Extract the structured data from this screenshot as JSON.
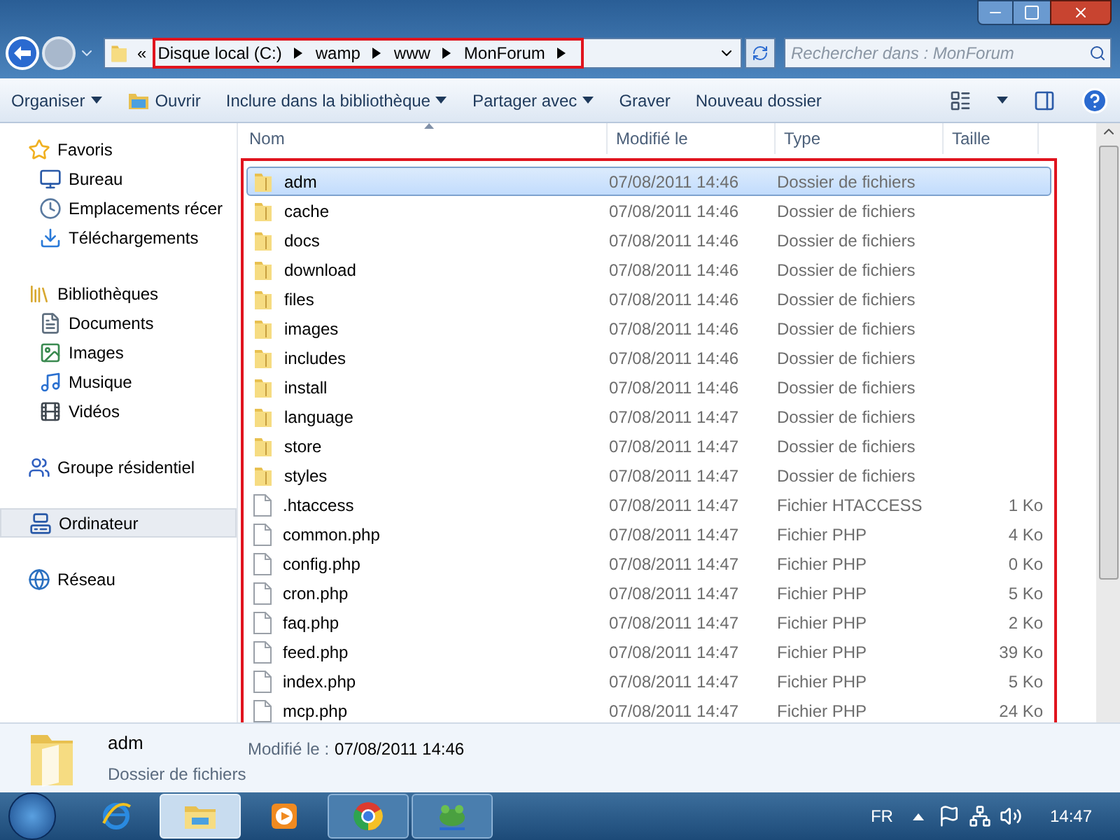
{
  "address": {
    "overflow": "«",
    "crumbs": [
      "Disque local (C:)",
      "wamp",
      "www",
      "MonForum"
    ]
  },
  "search": {
    "placeholder": "Rechercher dans : MonForum"
  },
  "toolbar": [
    {
      "label": "Organiser",
      "dropdown": true,
      "icon": false
    },
    {
      "label": "Ouvrir",
      "dropdown": false,
      "icon": true
    },
    {
      "label": "Inclure dans la bibliothèque",
      "dropdown": true,
      "icon": false
    },
    {
      "label": "Partager avec",
      "dropdown": true,
      "icon": false
    },
    {
      "label": "Graver",
      "dropdown": false,
      "icon": false
    },
    {
      "label": "Nouveau dossier",
      "dropdown": false,
      "icon": false
    }
  ],
  "sidebar": [
    {
      "label": "Favoris",
      "kind": "star",
      "selected": false,
      "children": [
        {
          "label": "Bureau",
          "kind": "desktop",
          "selected": false
        },
        {
          "label": "Emplacements récer",
          "kind": "recent",
          "selected": false
        },
        {
          "label": "Téléchargements",
          "kind": "download",
          "selected": false
        }
      ]
    },
    {
      "label": "Bibliothèques",
      "kind": "library",
      "selected": false,
      "children": [
        {
          "label": "Documents",
          "kind": "document",
          "selected": false
        },
        {
          "label": "Images",
          "kind": "image",
          "selected": false
        },
        {
          "label": "Musique",
          "kind": "music",
          "selected": false
        },
        {
          "label": "Vidéos",
          "kind": "video",
          "selected": false
        }
      ]
    },
    {
      "label": "Groupe résidentiel",
      "kind": "homegroup",
      "selected": false
    },
    {
      "label": "Ordinateur",
      "kind": "computer",
      "selected": true
    },
    {
      "label": "Réseau",
      "kind": "network",
      "selected": false
    }
  ],
  "table": {
    "columns": [
      {
        "label": "Nom",
        "sorted": true
      },
      {
        "label": "Modifié le",
        "sorted": false
      },
      {
        "label": "Type",
        "sorted": false
      },
      {
        "label": "Taille",
        "sorted": false
      }
    ],
    "rows": [
      {
        "name": "adm",
        "date": "07/08/2011 14:46",
        "type": "Dossier de fichiers",
        "kind": "folder",
        "selected": true
      },
      {
        "name": "cache",
        "date": "07/08/2011 14:46",
        "type": "Dossier de fichiers",
        "kind": "folder",
        "selected": false
      },
      {
        "name": "docs",
        "date": "07/08/2011 14:46",
        "type": "Dossier de fichiers",
        "kind": "folder",
        "selected": false
      },
      {
        "name": "download",
        "date": "07/08/2011 14:46",
        "type": "Dossier de fichiers",
        "kind": "folder",
        "selected": false
      },
      {
        "name": "files",
        "date": "07/08/2011 14:46",
        "type": "Dossier de fichiers",
        "kind": "folder",
        "selected": false
      },
      {
        "name": "images",
        "date": "07/08/2011 14:46",
        "type": "Dossier de fichiers",
        "kind": "folder",
        "selected": false
      },
      {
        "name": "includes",
        "date": "07/08/2011 14:46",
        "type": "Dossier de fichiers",
        "kind": "folder",
        "selected": false
      },
      {
        "name": "install",
        "date": "07/08/2011 14:46",
        "type": "Dossier de fichiers",
        "kind": "folder",
        "selected": false
      },
      {
        "name": "language",
        "date": "07/08/2011 14:47",
        "type": "Dossier de fichiers",
        "kind": "folder",
        "selected": false
      },
      {
        "name": "store",
        "date": "07/08/2011 14:47",
        "type": "Dossier de fichiers",
        "kind": "folder",
        "selected": false
      },
      {
        "name": "styles",
        "date": "07/08/2011 14:47",
        "type": "Dossier de fichiers",
        "kind": "folder",
        "selected": false
      },
      {
        "name": ".htaccess",
        "date": "07/08/2011 14:47",
        "type": "Fichier HTACCESS",
        "size": "1 Ko",
        "kind": "file",
        "selected": false
      },
      {
        "name": "common.php",
        "date": "07/08/2011 14:47",
        "type": "Fichier PHP",
        "size": "4 Ko",
        "kind": "file",
        "selected": false
      },
      {
        "name": "config.php",
        "date": "07/08/2011 14:47",
        "type": "Fichier PHP",
        "size": "0 Ko",
        "kind": "file",
        "selected": false
      },
      {
        "name": "cron.php",
        "date": "07/08/2011 14:47",
        "type": "Fichier PHP",
        "size": "5 Ko",
        "kind": "file",
        "selected": false
      },
      {
        "name": "faq.php",
        "date": "07/08/2011 14:47",
        "type": "Fichier PHP",
        "size": "2 Ko",
        "kind": "file",
        "selected": false
      },
      {
        "name": "feed.php",
        "date": "07/08/2011 14:47",
        "type": "Fichier PHP",
        "size": "39 Ko",
        "kind": "file",
        "selected": false
      },
      {
        "name": "index.php",
        "date": "07/08/2011 14:47",
        "type": "Fichier PHP",
        "size": "5 Ko",
        "kind": "file",
        "selected": false
      },
      {
        "name": "mcp.php",
        "date": "07/08/2011 14:47",
        "type": "Fichier PHP",
        "size": "24 Ko",
        "kind": "file",
        "selected": false
      }
    ]
  },
  "details": {
    "name": "adm",
    "type": "Dossier de fichiers",
    "modified_label": "Modifié le :",
    "modified": "07/08/2011 14:46"
  },
  "taskbar": {
    "apps": [
      {
        "kind": "browser-e",
        "active": false
      },
      {
        "kind": "explorer",
        "active": true
      },
      {
        "kind": "media",
        "active": false
      },
      {
        "kind": "chrome",
        "active": true
      },
      {
        "kind": "frog",
        "active": true
      }
    ],
    "language": "FR",
    "clock": "14:47"
  }
}
